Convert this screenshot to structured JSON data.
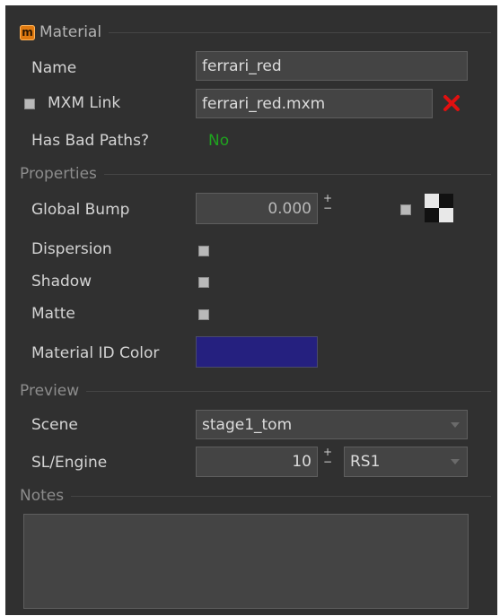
{
  "material_section": {
    "icon": "material-icon",
    "icon_letter": "m",
    "title": "Material",
    "name_label": "Name",
    "name_value": "ferrari_red",
    "mxm_link_label": "MXM Link",
    "mxm_link_value": "ferrari_red.mxm",
    "remove_link_icon": "close-x-icon",
    "bad_paths_label": "Has Bad Paths?",
    "bad_paths_value": "No",
    "bad_paths_color": "#1fa31f"
  },
  "properties_section": {
    "title": "Properties",
    "global_bump_label": "Global Bump",
    "global_bump_value": "0.000",
    "spin_plus": "+",
    "spin_minus": "−",
    "bump_map_icon": "checker-texture-icon",
    "dispersion_label": "Dispersion",
    "shadow_label": "Shadow",
    "matte_label": "Matte",
    "material_id_color_label": "Material ID Color",
    "material_id_color": "#25207f"
  },
  "preview_section": {
    "title": "Preview",
    "scene_label": "Scene",
    "scene_value": "stage1_tom",
    "sl_engine_label": "SL/Engine",
    "sl_value": "10",
    "spin_plus": "+",
    "spin_minus": "−",
    "engine_value": "RS1"
  },
  "notes_section": {
    "title": "Notes",
    "notes_value": ""
  }
}
